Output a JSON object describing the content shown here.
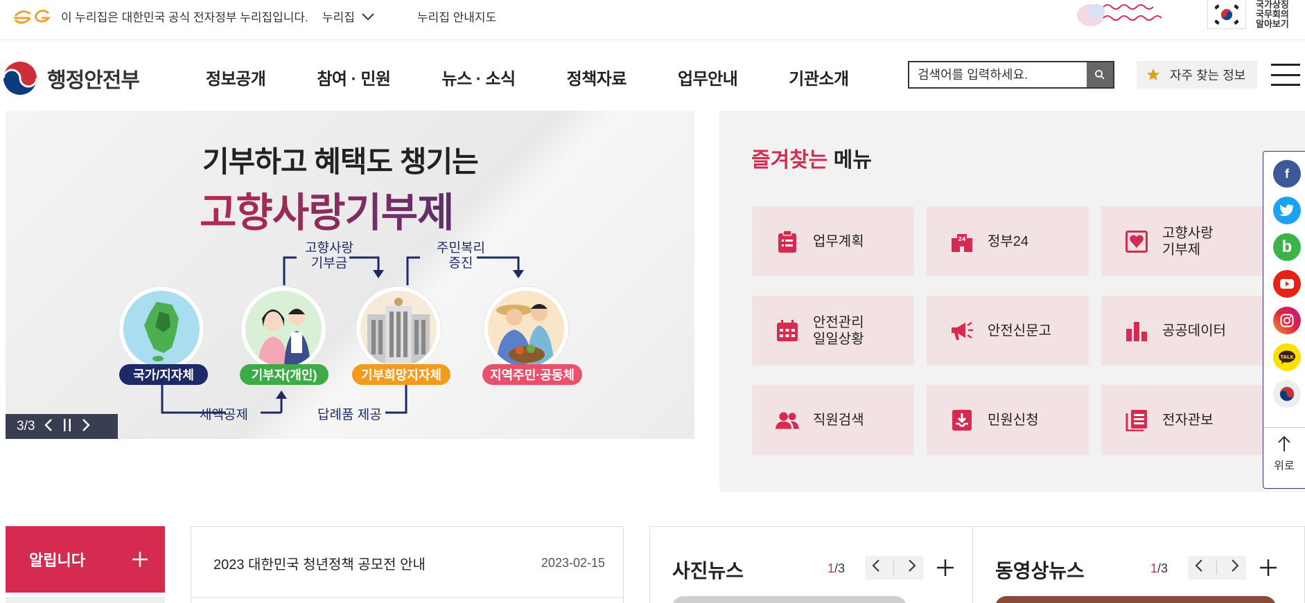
{
  "topbar": {
    "gov_notice": "이 누리집은 대한민국 공식 전자정부 누리집입니다.",
    "nurijib": "누리집",
    "nurijib_map": "누리집 안내지도",
    "symbol_line1": "국가상징",
    "symbol_line2": "국무회의",
    "symbol_line3": "알아보기"
  },
  "header": {
    "logo_text": "행정안전부",
    "gnb": [
      "정보공개",
      "참여 · 민원",
      "뉴스 · 소식",
      "정책자료",
      "업무안내",
      "기관소개"
    ],
    "search_placeholder": "검색어를 입력하세요.",
    "favorite_label": "자주 찾는 정보"
  },
  "banner": {
    "title_line1": "기부하고 혜택도 챙기는",
    "title_line2": "고향사랑기부제",
    "flow_label_1": "고향사랑\n기부금",
    "flow_label_2": "주민복리\n증진",
    "pills": [
      "국가/지자체",
      "기부자(개인)",
      "기부희망지자체",
      "지역주민·공동체"
    ],
    "bottom_label_1": "세액공제",
    "bottom_label_2": "답례품 제공",
    "counter": "3/3",
    "colors": {
      "navy": "#1d2a66",
      "green": "#3dab48",
      "orange": "#f29b1d",
      "pink": "#e9516b",
      "title_red": "#b8294c"
    }
  },
  "favorites": {
    "title_accent": "즐겨찾는",
    "title_rest": " 메뉴",
    "items": [
      {
        "label": "업무계획",
        "icon": "clipboard-icon"
      },
      {
        "label": "정부24",
        "icon": "building-24-icon"
      },
      {
        "label": "고향사랑\n기부제",
        "icon": "heart-icon"
      },
      {
        "label": "안전관리\n일일상황",
        "icon": "calendar-icon"
      },
      {
        "label": "안전신문고",
        "icon": "megaphone-icon"
      },
      {
        "label": "공공데이터",
        "icon": "bar-chart-icon"
      },
      {
        "label": "직원검색",
        "icon": "people-icon"
      },
      {
        "label": "민원신청",
        "icon": "inbox-download-icon"
      },
      {
        "label": "전자관보",
        "icon": "document-icon"
      }
    ],
    "accent_color": "#d52b51"
  },
  "sns": {
    "items": [
      {
        "name": "facebook-icon",
        "glyph": "f",
        "color": "#3b5998"
      },
      {
        "name": "twitter-icon",
        "glyph": "t",
        "color": "#1da1f2"
      },
      {
        "name": "blog-icon",
        "glyph": "b",
        "color": "#3bb34a"
      },
      {
        "name": "youtube-icon",
        "glyph": "▶",
        "color": "#e62117"
      },
      {
        "name": "instagram-icon",
        "glyph": "◎",
        "color": "#c13584"
      },
      {
        "name": "kakaotalk-icon",
        "glyph": "TALK",
        "color": "#fae100"
      },
      {
        "name": "mois-channel-icon",
        "glyph": "●",
        "color": "#eeeeee"
      }
    ],
    "top_label": "위로"
  },
  "notice": {
    "tab_label": "알립니다",
    "item_title": "2023 대한민국 청년정책 공모전 안내",
    "item_date": "2023-02-15"
  },
  "photo_news": {
    "title": "사진뉴스",
    "page_current": "1",
    "page_total": "/3"
  },
  "video_news": {
    "title": "동영상뉴스",
    "page_current": "1",
    "page_total": "/3"
  }
}
